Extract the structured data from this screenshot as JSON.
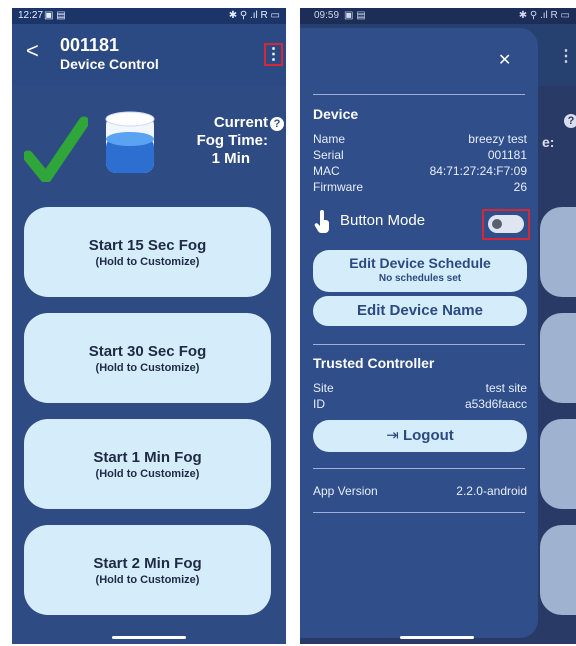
{
  "left": {
    "status": {
      "time": "12:27",
      "right_icons": "✱ ⚲ .ıl R ▭"
    },
    "appbar": {
      "title": "001181",
      "subtitle": "Device Control"
    },
    "fog_time": {
      "line1": "Current",
      "line2": "Fog Time:",
      "line3": "1 Min"
    },
    "buttons": [
      {
        "label": "Start 15 Sec Fog",
        "sub": "(Hold to Customize)"
      },
      {
        "label": "Start 30 Sec Fog",
        "sub": "(Hold to Customize)"
      },
      {
        "label": "Start 1 Min Fog",
        "sub": "(Hold to Customize)"
      },
      {
        "label": "Start 2 Min Fog",
        "sub": "(Hold to Customize)"
      }
    ]
  },
  "right": {
    "status": {
      "time": "09:59",
      "right_icons": "✱ ⚲ .ıl R ▭"
    },
    "bg": {
      "partial_label": "e:",
      "more_icon": "⋮"
    },
    "drawer": {
      "close": "✕",
      "device": {
        "title": "Device",
        "rows": [
          {
            "label": "Name",
            "value": "breezy test"
          },
          {
            "label": "Serial",
            "value": "001181"
          },
          {
            "label": "MAC",
            "value": "84:71:27:24:F7:09"
          },
          {
            "label": "Firmware",
            "value": "26"
          }
        ]
      },
      "button_mode": {
        "label": "Button Mode"
      },
      "edit_schedule": {
        "title": "Edit Device Schedule",
        "sub": "No schedules set"
      },
      "edit_name": {
        "label": "Edit Device Name"
      },
      "trusted": {
        "title": "Trusted Controller",
        "rows": [
          {
            "label": "Site",
            "value": "test site"
          },
          {
            "label": "ID",
            "value": "a53d6faacc"
          }
        ]
      },
      "logout": {
        "label": "Logout"
      },
      "app_version": {
        "label": "App Version",
        "value": "2.2.0-android"
      }
    }
  },
  "colors": {
    "primary": "#2e4b83",
    "light_button": "#d5ecfb",
    "check_green": "#2fa53a",
    "highlight_red": "#d3283a"
  }
}
